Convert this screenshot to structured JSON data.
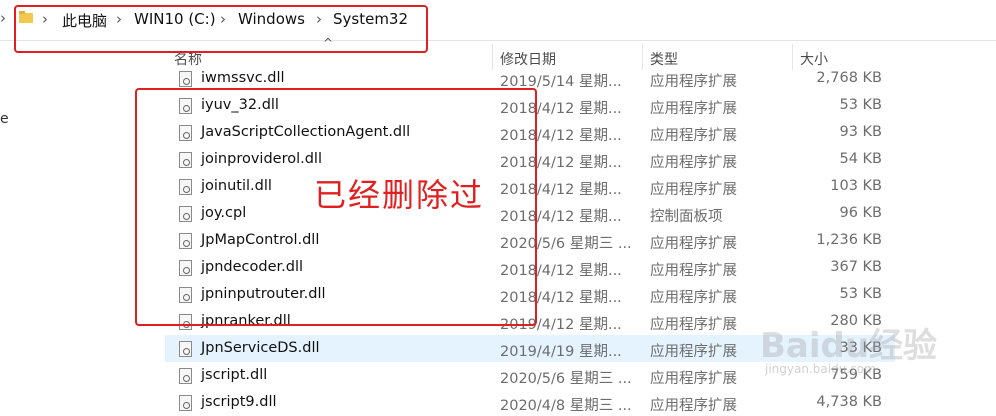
{
  "breadcrumb": {
    "items": [
      "此电脑",
      "WIN10 (C:)",
      "Windows",
      "System32"
    ]
  },
  "nav_fragment": "e",
  "annotation_text": "已经删除过",
  "columns": {
    "name": "名称",
    "date": "修改日期",
    "type": "类型",
    "size": "大小"
  },
  "files": [
    {
      "name": "iwmssvc.dll",
      "date": "2019/5/14 星期...",
      "type": "应用程序扩展",
      "size": "2,768 KB"
    },
    {
      "name": "iyuv_32.dll",
      "date": "2018/4/12 星期...",
      "type": "应用程序扩展",
      "size": "53 KB"
    },
    {
      "name": "JavaScriptCollectionAgent.dll",
      "date": "2018/4/12 星期...",
      "type": "应用程序扩展",
      "size": "93 KB"
    },
    {
      "name": "joinproviderol.dll",
      "date": "2018/4/12 星期...",
      "type": "应用程序扩展",
      "size": "54 KB"
    },
    {
      "name": "joinutil.dll",
      "date": "2018/4/12 星期...",
      "type": "应用程序扩展",
      "size": "103 KB"
    },
    {
      "name": "joy.cpl",
      "date": "2018/4/12 星期...",
      "type": "控制面板项",
      "size": "96 KB"
    },
    {
      "name": "JpMapControl.dll",
      "date": "2020/5/6 星期三 ...",
      "type": "应用程序扩展",
      "size": "1,236 KB"
    },
    {
      "name": "jpndecoder.dll",
      "date": "2018/4/12 星期...",
      "type": "应用程序扩展",
      "size": "367 KB"
    },
    {
      "name": "jpninputrouter.dll",
      "date": "2018/4/12 星期...",
      "type": "应用程序扩展",
      "size": "53 KB"
    },
    {
      "name": "jpnranker.dll",
      "date": "2019/4/12 星期...",
      "type": "应用程序扩展",
      "size": "280 KB"
    },
    {
      "name": "JpnServiceDS.dll",
      "date": "2019/4/19 星期...",
      "type": "应用程序扩展",
      "size": "33 KB"
    },
    {
      "name": "jscript.dll",
      "date": "2020/5/6 星期三 ...",
      "type": "应用程序扩展",
      "size": "759 KB"
    },
    {
      "name": "jscript9.dll",
      "date": "2020/4/8 星期三 ...",
      "type": "应用程序扩展",
      "size": "4,738 KB"
    }
  ],
  "selected_file": "JpnServiceDS.dll",
  "watermark": {
    "brand": "Baidu经验",
    "url": "jingyan.baidu.com"
  },
  "colors": {
    "annotation_red": "#e02020",
    "selected_row": "#e5f3ff",
    "folder_yellow": "#f2c94c"
  }
}
